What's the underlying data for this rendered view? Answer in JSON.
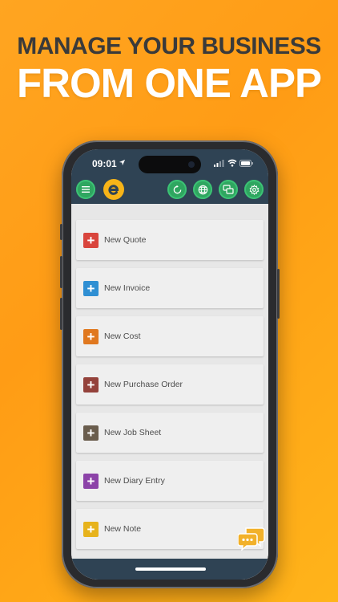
{
  "hero": {
    "line1": "MANAGE YOUR BUSINESS",
    "line2": "FROM ONE APP"
  },
  "status_bar": {
    "time": "09:01",
    "icons": [
      "location-arrow-icon",
      "signal-icon",
      "wifi-icon",
      "battery-icon"
    ]
  },
  "toolbar": {
    "left_buttons": [
      "menu-icon",
      "app-logo"
    ],
    "right_buttons": [
      "refresh-icon",
      "globe-icon",
      "messages-icon",
      "settings-icon"
    ],
    "accent_green": "#2fa660",
    "bar_color": "#2f4354",
    "logo_color": "#f7b418"
  },
  "actions": [
    {
      "label": "New Quote",
      "color": "#d9453d"
    },
    {
      "label": "New Invoice",
      "color": "#2f8fd3"
    },
    {
      "label": "New Cost",
      "color": "#e0781f"
    },
    {
      "label": "New Purchase Order",
      "color": "#94423b"
    },
    {
      "label": "New Job Sheet",
      "color": "#6a5d4d"
    },
    {
      "label": "New Diary Entry",
      "color": "#8c43a8"
    },
    {
      "label": "New Note",
      "color": "#e7b31c"
    }
  ],
  "chat_button": {
    "icon": "chat-bubbles-icon",
    "color": "#f2b12a"
  }
}
